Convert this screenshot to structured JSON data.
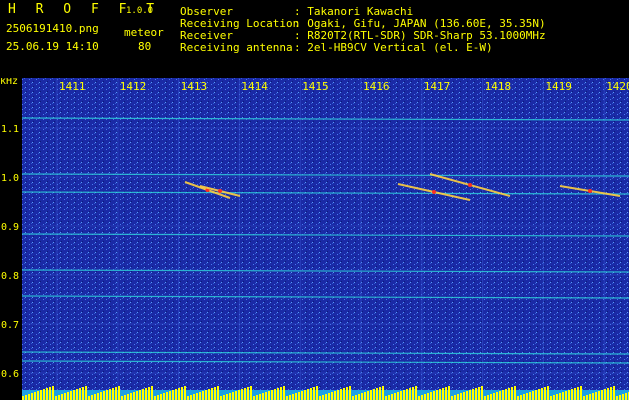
{
  "header": {
    "app_name": "H R O F F T",
    "version": "1.0.0",
    "filename": "2506191410.png",
    "mode": "meteor",
    "datetime": "25.06.19 14:10",
    "count": "80",
    "labels": {
      "observer": "Observer",
      "location": "Receiving Location",
      "receiver": "Receiver",
      "antenna": "Receiving antenna"
    },
    "values": {
      "observer": ": Takanori Kawachi",
      "location": ": Ogaki, Gifu, JAPAN (136.60E, 35.35N)",
      "receiver": ": R820T2(RTL-SDR) SDR-Sharp 53.1000MHz",
      "antenna": ": 2el-HB9CV Vertical (el. E-W)"
    }
  },
  "spectrogram": {
    "unit_label": "kHz",
    "time_ticks": [
      "1411",
      "1412",
      "1413",
      "1414",
      "1415",
      "1416",
      "1417",
      "1418",
      "1419",
      "1420"
    ],
    "freq_ticks": [
      "1.1",
      "1.0",
      "0.9",
      "0.8",
      "0.7",
      "0.6"
    ],
    "colors": {
      "background": "#1a2aa6",
      "trace": "#30e0e0",
      "meteor_head": "#ff3020",
      "signal_bar": "#ffff00"
    }
  }
}
